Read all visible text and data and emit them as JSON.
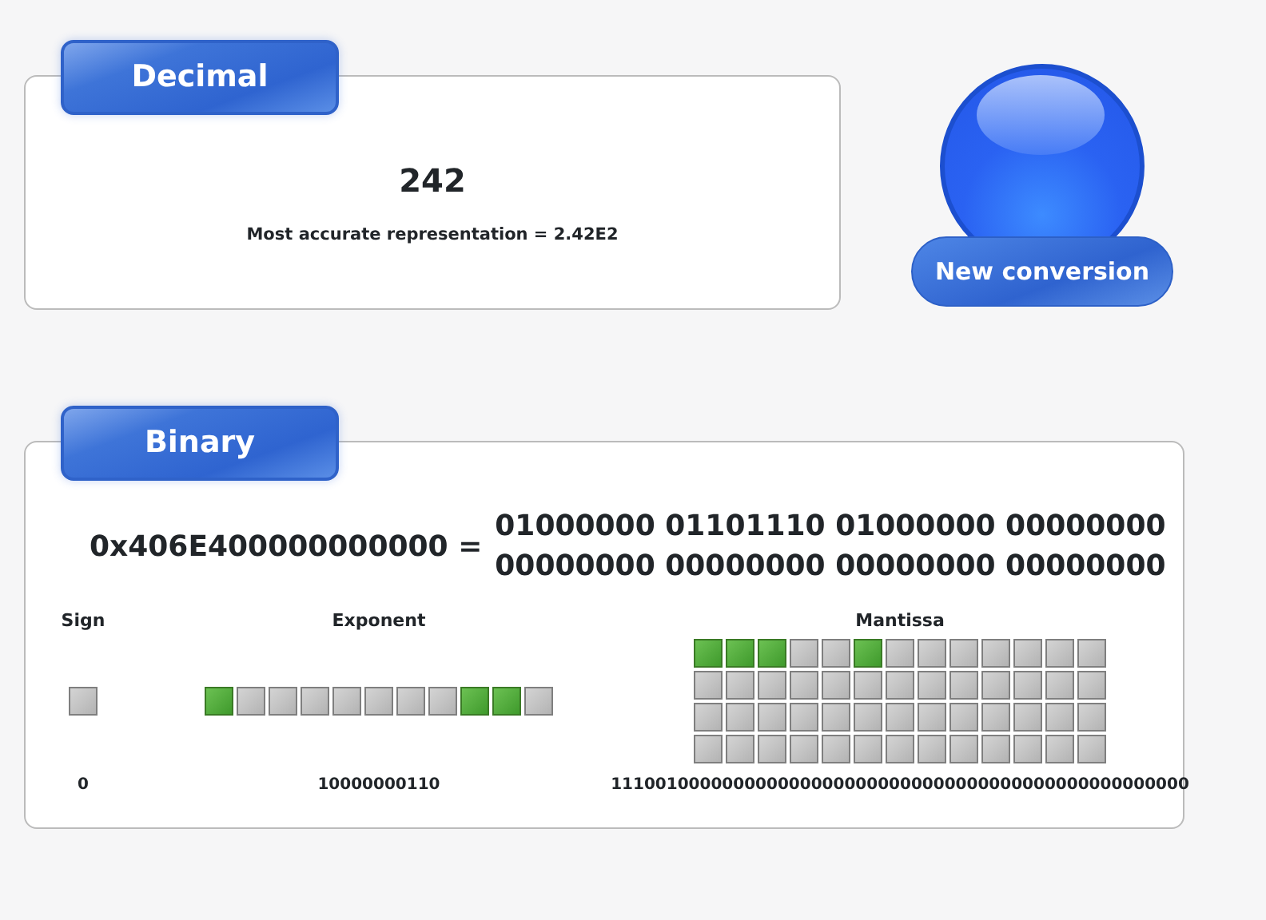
{
  "decimal": {
    "tab": "Decimal",
    "value": "242",
    "representation": "Most accurate representation = 2.42E2"
  },
  "new_conversion_button": "New conversion",
  "binary": {
    "tab": "Binary",
    "hex": "0x406E400000000000 =",
    "binary_lines": [
      "01000000 01101110 01000000 00000000",
      "00000000 00000000 00000000 00000000"
    ],
    "fields": [
      {
        "label": "Sign",
        "value": "0",
        "bits": [
          {
            "on": false
          }
        ]
      },
      {
        "label": "Exponent",
        "value": "10000000110",
        "bits": [
          {
            "on": true
          },
          {
            "on": false
          },
          {
            "on": false
          },
          {
            "on": false
          },
          {
            "on": false
          },
          {
            "on": false
          },
          {
            "on": false
          },
          {
            "on": false
          },
          {
            "on": true
          },
          {
            "on": true
          },
          {
            "on": false
          }
        ]
      },
      {
        "label": "Mantissa",
        "value": "1110010000000000000000000000000000000000000000000000",
        "bits": [
          {
            "on": true
          },
          {
            "on": true
          },
          {
            "on": true
          },
          {
            "on": false
          },
          {
            "on": false
          },
          {
            "on": true
          },
          {
            "on": false
          },
          {
            "on": false
          },
          {
            "on": false
          },
          {
            "on": false
          },
          {
            "on": false
          },
          {
            "on": false
          },
          {
            "on": false
          },
          {
            "on": false
          },
          {
            "on": false
          },
          {
            "on": false
          },
          {
            "on": false
          },
          {
            "on": false
          },
          {
            "on": false
          },
          {
            "on": false
          },
          {
            "on": false
          },
          {
            "on": false
          },
          {
            "on": false
          },
          {
            "on": false
          },
          {
            "on": false
          },
          {
            "on": false
          },
          {
            "on": false
          },
          {
            "on": false
          },
          {
            "on": false
          },
          {
            "on": false
          },
          {
            "on": false
          },
          {
            "on": false
          },
          {
            "on": false
          },
          {
            "on": false
          },
          {
            "on": false
          },
          {
            "on": false
          },
          {
            "on": false
          },
          {
            "on": false
          },
          {
            "on": false
          },
          {
            "on": false
          },
          {
            "on": false
          },
          {
            "on": false
          },
          {
            "on": false
          },
          {
            "on": false
          },
          {
            "on": false
          },
          {
            "on": false
          },
          {
            "on": false
          },
          {
            "on": false
          },
          {
            "on": false
          },
          {
            "on": false
          },
          {
            "on": false
          },
          {
            "on": false
          }
        ]
      }
    ]
  }
}
